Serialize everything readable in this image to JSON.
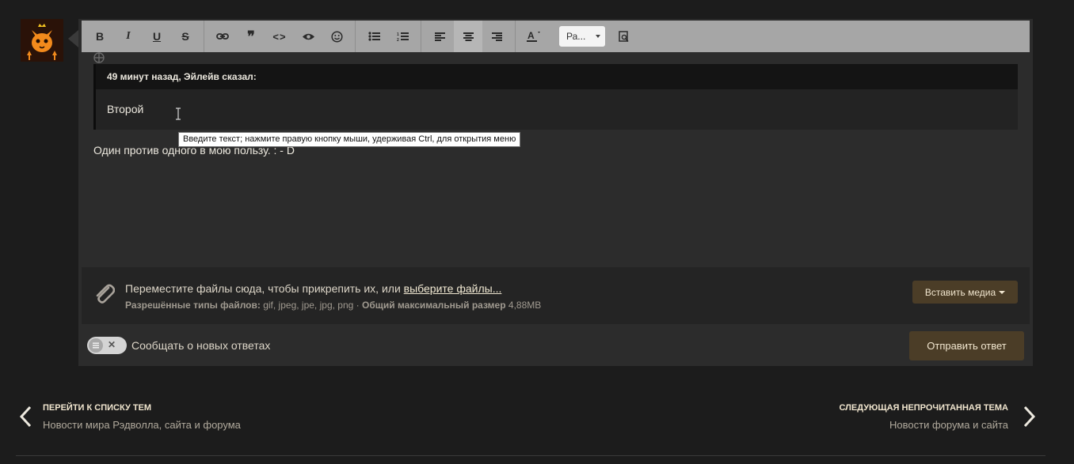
{
  "toolbar": {
    "font_select": "Ра...",
    "buttons": [
      "bold",
      "italic",
      "underline",
      "strikethrough",
      "link",
      "quote",
      "code",
      "spoiler",
      "emoji",
      "bullet-list",
      "numbered-list",
      "align-left",
      "align-center",
      "align-right",
      "text-color",
      "preview"
    ],
    "icons": {
      "bold": "B",
      "italic": "I",
      "underline": "U",
      "strike": "S",
      "quote": "❞",
      "code": "<>"
    }
  },
  "quote": {
    "header": "49 минут назад, Эйлейв сказал:",
    "body": "Второй"
  },
  "tooltip": "Введите текст; нажмите правую кнопку мыши, удерживая Ctrl, для открытия меню",
  "reply_text": "Один против одного в мою пользу. : - D",
  "attachments": {
    "drop_text": "Переместите файлы сюда, чтобы прикрепить их, или",
    "choose_link": "выберите файлы...",
    "types_label": "Разрешённые типы файлов:",
    "types_value": "gif, jpeg, jpe, jpg, png",
    "separator": "·",
    "max_label": "Общий максимальный размер",
    "max_value": "4,88MB",
    "insert_media": "Вставить медиа"
  },
  "notify": {
    "label": "Сообщать о новых ответах",
    "state": "off",
    "off_glyph": "✕"
  },
  "submit": "Отправить ответ",
  "nav": {
    "prev_title": "ПЕРЕЙТИ К СПИСКУ ТЕМ",
    "prev_sub": "Новости мира Рэдволла, сайта и форума",
    "next_title": "СЛЕДУЮЩАЯ НЕПРОЧИТАННАЯ ТЕМА",
    "next_sub": "Новости форума и сайта"
  },
  "colors": {
    "page_bg": "#1c1c1c",
    "editor_bg": "#2c2c2c",
    "toolbar_bg": "#a6a6a6",
    "button_bg": "#4b3d27",
    "avatar_orange": "#f28a1c"
  }
}
